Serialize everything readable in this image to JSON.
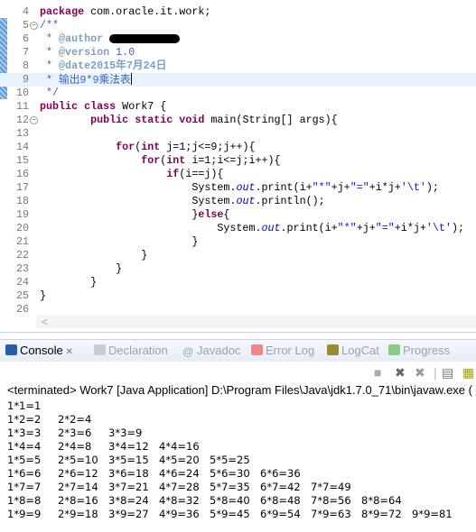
{
  "editor": {
    "current_line": 9,
    "redacted_author": true,
    "lines": [
      {
        "n": 4,
        "fold": "",
        "seg": [
          [
            "package",
            "kw"
          ],
          [
            " com.oracle.it.work;",
            "tx"
          ]
        ]
      },
      {
        "n": 5,
        "fold": "-",
        "seg": [
          [
            "/**",
            "jd"
          ]
        ]
      },
      {
        "n": 6,
        "fold": "",
        "seg": [
          [
            " * ",
            "jd"
          ],
          [
            "@author",
            "tag"
          ],
          [
            " ",
            "jd"
          ],
          [
            "",
            "redact"
          ]
        ]
      },
      {
        "n": 7,
        "fold": "",
        "seg": [
          [
            " * ",
            "jd"
          ],
          [
            "@version",
            "tag"
          ],
          [
            " 1.0",
            "jd"
          ]
        ]
      },
      {
        "n": 8,
        "fold": "",
        "seg": [
          [
            " * ",
            "jd"
          ],
          [
            "@date2015年7月24日",
            "tag"
          ]
        ]
      },
      {
        "n": 9,
        "fold": "",
        "seg": [
          [
            " * ",
            "jd"
          ],
          [
            "输出9*9乘法表",
            "jd"
          ]
        ]
      },
      {
        "n": 10,
        "fold": "",
        "seg": [
          [
            " */",
            "jd"
          ]
        ]
      },
      {
        "n": 11,
        "fold": "",
        "seg": [
          [
            "public class",
            "kw"
          ],
          [
            " Work7 {",
            "tx"
          ]
        ]
      },
      {
        "n": 12,
        "fold": "-",
        "seg": [
          [
            "        ",
            "tx"
          ],
          [
            "public static void",
            "kw"
          ],
          [
            " main(String[] args){",
            "tx"
          ]
        ]
      },
      {
        "n": 13,
        "fold": "",
        "seg": []
      },
      {
        "n": 14,
        "fold": "",
        "seg": [
          [
            "            ",
            "tx"
          ],
          [
            "for",
            "kw"
          ],
          [
            "(",
            "tx"
          ],
          [
            "int",
            "kw"
          ],
          [
            " j=1;j<=9;j++){",
            "tx"
          ]
        ]
      },
      {
        "n": 15,
        "fold": "",
        "seg": [
          [
            "                ",
            "tx"
          ],
          [
            "for",
            "kw"
          ],
          [
            "(",
            "tx"
          ],
          [
            "int",
            "kw"
          ],
          [
            " i=1;i<=j;i++){",
            "tx"
          ]
        ]
      },
      {
        "n": 16,
        "fold": "",
        "seg": [
          [
            "                    ",
            "tx"
          ],
          [
            "if",
            "kw"
          ],
          [
            "(i==j){",
            "tx"
          ]
        ]
      },
      {
        "n": 17,
        "fold": "",
        "seg": [
          [
            "                        System.",
            "tx"
          ],
          [
            "out",
            "fld"
          ],
          [
            ".print(i+",
            "tx"
          ],
          [
            "\"*\"",
            "str"
          ],
          [
            "+j+",
            "tx"
          ],
          [
            "\"=\"",
            "str"
          ],
          [
            "+i*j+",
            "tx"
          ],
          [
            "'\\t'",
            "str"
          ],
          [
            ");",
            "tx"
          ]
        ]
      },
      {
        "n": 18,
        "fold": "",
        "seg": [
          [
            "                        System.",
            "tx"
          ],
          [
            "out",
            "fld"
          ],
          [
            ".println();",
            "tx"
          ]
        ]
      },
      {
        "n": 19,
        "fold": "",
        "seg": [
          [
            "                        }",
            "tx"
          ],
          [
            "else",
            "kw"
          ],
          [
            "{",
            "tx"
          ]
        ]
      },
      {
        "n": 20,
        "fold": "",
        "seg": [
          [
            "                            System.",
            "tx"
          ],
          [
            "out",
            "fld"
          ],
          [
            ".print(i+",
            "tx"
          ],
          [
            "\"*\"",
            "str"
          ],
          [
            "+j+",
            "tx"
          ],
          [
            "\"=\"",
            "str"
          ],
          [
            "+i*j+",
            "tx"
          ],
          [
            "'\\t'",
            "str"
          ],
          [
            ");",
            "tx"
          ]
        ]
      },
      {
        "n": 21,
        "fold": "",
        "seg": [
          [
            "                        }",
            "tx"
          ]
        ]
      },
      {
        "n": 22,
        "fold": "",
        "seg": [
          [
            "                }",
            "tx"
          ]
        ]
      },
      {
        "n": 23,
        "fold": "",
        "seg": [
          [
            "            }",
            "tx"
          ]
        ]
      },
      {
        "n": 24,
        "fold": "",
        "seg": [
          [
            "        }",
            "tx"
          ]
        ]
      },
      {
        "n": 25,
        "fold": "",
        "seg": [
          [
            "}",
            "tx"
          ]
        ]
      },
      {
        "n": 26,
        "fold": "",
        "seg": []
      }
    ],
    "scroll_left_glyph": "<"
  },
  "panel": {
    "tabs": [
      {
        "label": "Console",
        "icon": "console-icon",
        "active": true,
        "close": "✕"
      },
      {
        "label": "Declaration",
        "icon": "declaration-icon"
      },
      {
        "label": "Javadoc",
        "icon": "javadoc-icon",
        "glyph": "@"
      },
      {
        "label": "Error Log",
        "icon": "error-log-icon"
      },
      {
        "label": "LogCat",
        "icon": "logcat-icon"
      },
      {
        "label": "Progress",
        "icon": "progress-icon"
      }
    ],
    "status": "<terminated> Work7 [Java Application] D:\\Program Files\\Java\\jdk1.7.0_71\\bin\\javaw.exe (",
    "output": [
      [
        "1*1=1"
      ],
      [
        "1*2=2",
        "2*2=4"
      ],
      [
        "1*3=3",
        "2*3=6",
        "3*3=9"
      ],
      [
        "1*4=4",
        "2*4=8",
        "3*4=12",
        "4*4=16"
      ],
      [
        "1*5=5",
        "2*5=10",
        "3*5=15",
        "4*5=20",
        "5*5=25"
      ],
      [
        "1*6=6",
        "2*6=12",
        "3*6=18",
        "4*6=24",
        "5*6=30",
        "6*6=36"
      ],
      [
        "1*7=7",
        "2*7=14",
        "3*7=21",
        "4*7=28",
        "5*7=35",
        "6*7=42",
        "7*7=49"
      ],
      [
        "1*8=8",
        "2*8=16",
        "3*8=24",
        "4*8=32",
        "5*8=40",
        "6*8=48",
        "7*8=56",
        "8*8=64"
      ],
      [
        "1*9=9",
        "2*9=18",
        "3*9=27",
        "4*9=36",
        "5*9=45",
        "6*9=54",
        "7*9=63",
        "8*9=72",
        "9*9=81"
      ]
    ]
  }
}
